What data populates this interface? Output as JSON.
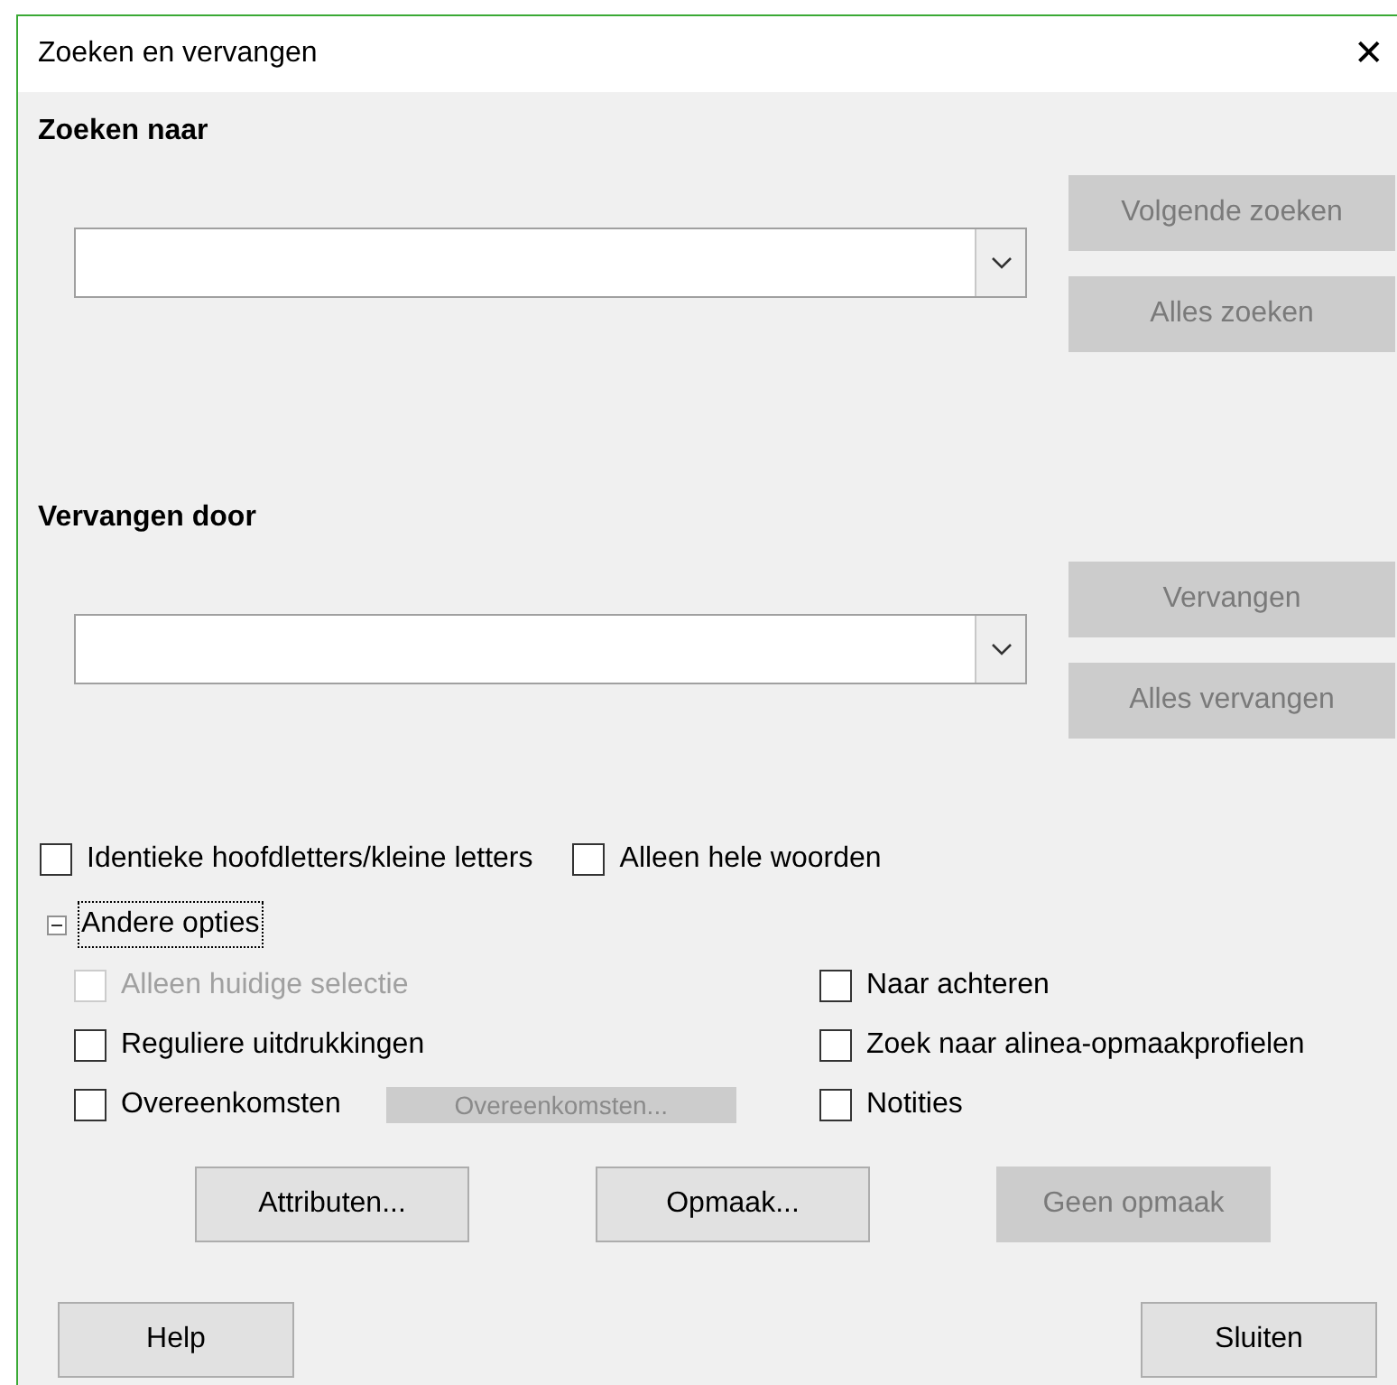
{
  "window": {
    "title": "Zoeken en vervangen",
    "close": "✕"
  },
  "search": {
    "label": "Zoeken naar",
    "buttons": [
      {
        "label": "Volgende zoeken",
        "disabled": true
      },
      {
        "label": "Alles zoeken",
        "disabled": true
      }
    ]
  },
  "replace": {
    "label": "Vervangen door",
    "buttons": [
      {
        "label": "Vervangen",
        "disabled": true
      },
      {
        "label": "Alles vervangen",
        "disabled": true
      }
    ]
  },
  "options": [
    {
      "label": "Identieke hoofdletters/kleine letters",
      "checked": false,
      "disabled": false
    },
    {
      "label": "Alleen hele woorden",
      "checked": false,
      "disabled": false
    }
  ],
  "more_options": {
    "label": "Andere opties",
    "expanded": true,
    "left": [
      {
        "label": "Alleen huidige selectie",
        "checked": false,
        "disabled": true
      },
      {
        "label": "Reguliere uitdrukkingen",
        "checked": false,
        "disabled": false
      },
      {
        "label": "Overeenkomsten",
        "checked": false,
        "disabled": false
      }
    ],
    "similarity_button": {
      "label": "Overeenkomsten...",
      "disabled": true
    },
    "right": [
      {
        "label": "Naar achteren",
        "checked": false,
        "disabled": false
      },
      {
        "label": "Zoek naar alinea-opmaakprofielen",
        "checked": false,
        "disabled": false
      },
      {
        "label": "Notities",
        "checked": false,
        "disabled": false
      }
    ],
    "buttons": [
      {
        "label": "Attributen...",
        "disabled": false
      },
      {
        "label": "Opmaak...",
        "disabled": false
      },
      {
        "label": "Geen opmaak",
        "disabled": true
      }
    ]
  },
  "footer_buttons": [
    {
      "label": "Help",
      "disabled": false
    },
    {
      "label": "Sluiten",
      "disabled": false
    }
  ]
}
